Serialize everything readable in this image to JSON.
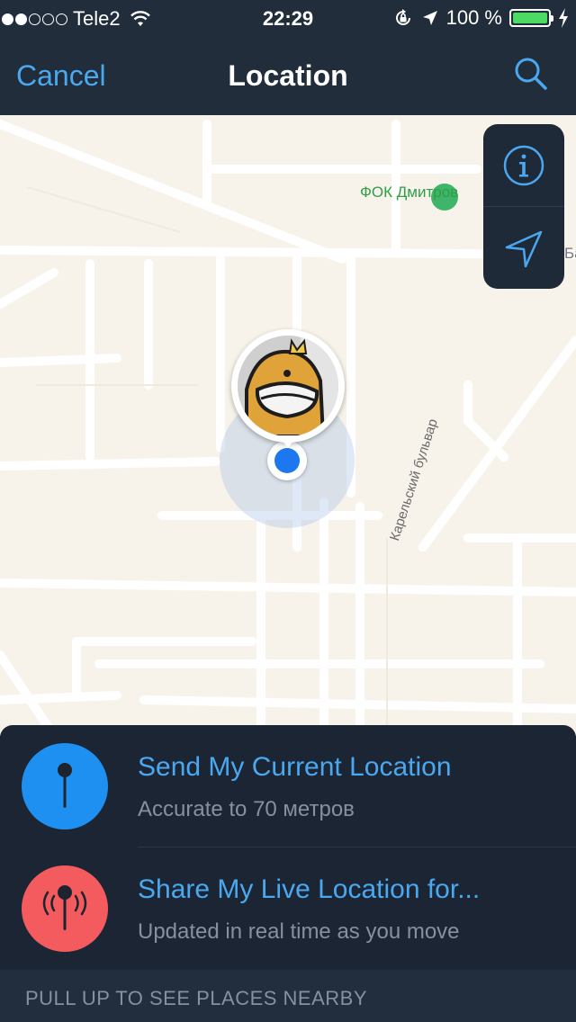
{
  "status_bar": {
    "signal_dots": [
      true,
      true,
      false,
      false,
      false
    ],
    "carrier": "Tele2",
    "time": "22:29",
    "battery": "100 %",
    "battery_level": 1.0,
    "icons": [
      "wifi-icon",
      "orientation-lock-icon",
      "location-arrow-icon",
      "battery-icon",
      "charging-bolt-icon"
    ]
  },
  "nav": {
    "cancel_label": "Cancel",
    "title": "Location",
    "search_icon": "search-icon"
  },
  "map": {
    "poi_label": "ФОК Дмитров",
    "street_label": "Карельский бульвар",
    "edge_label": "Ба",
    "controls": [
      "info-icon",
      "navigation-arrow-icon"
    ]
  },
  "actions": {
    "send": {
      "title": "Send My Current Location",
      "subtitle": "Accurate to 70 метров",
      "icon": "pin-icon"
    },
    "live": {
      "title": "Share My Live Location for...",
      "subtitle": "Updated in real time as you move",
      "icon": "live-pin-icon"
    }
  },
  "footer": {
    "text": "PULL UP TO SEE PLACES NEARBY"
  },
  "colors": {
    "accent": "#4aa8f0",
    "send_icon_bg": "#1e90f2",
    "live_icon_bg": "#f35b5f",
    "battery_fill": "#4cd964",
    "poi": "#2f9e4a"
  }
}
